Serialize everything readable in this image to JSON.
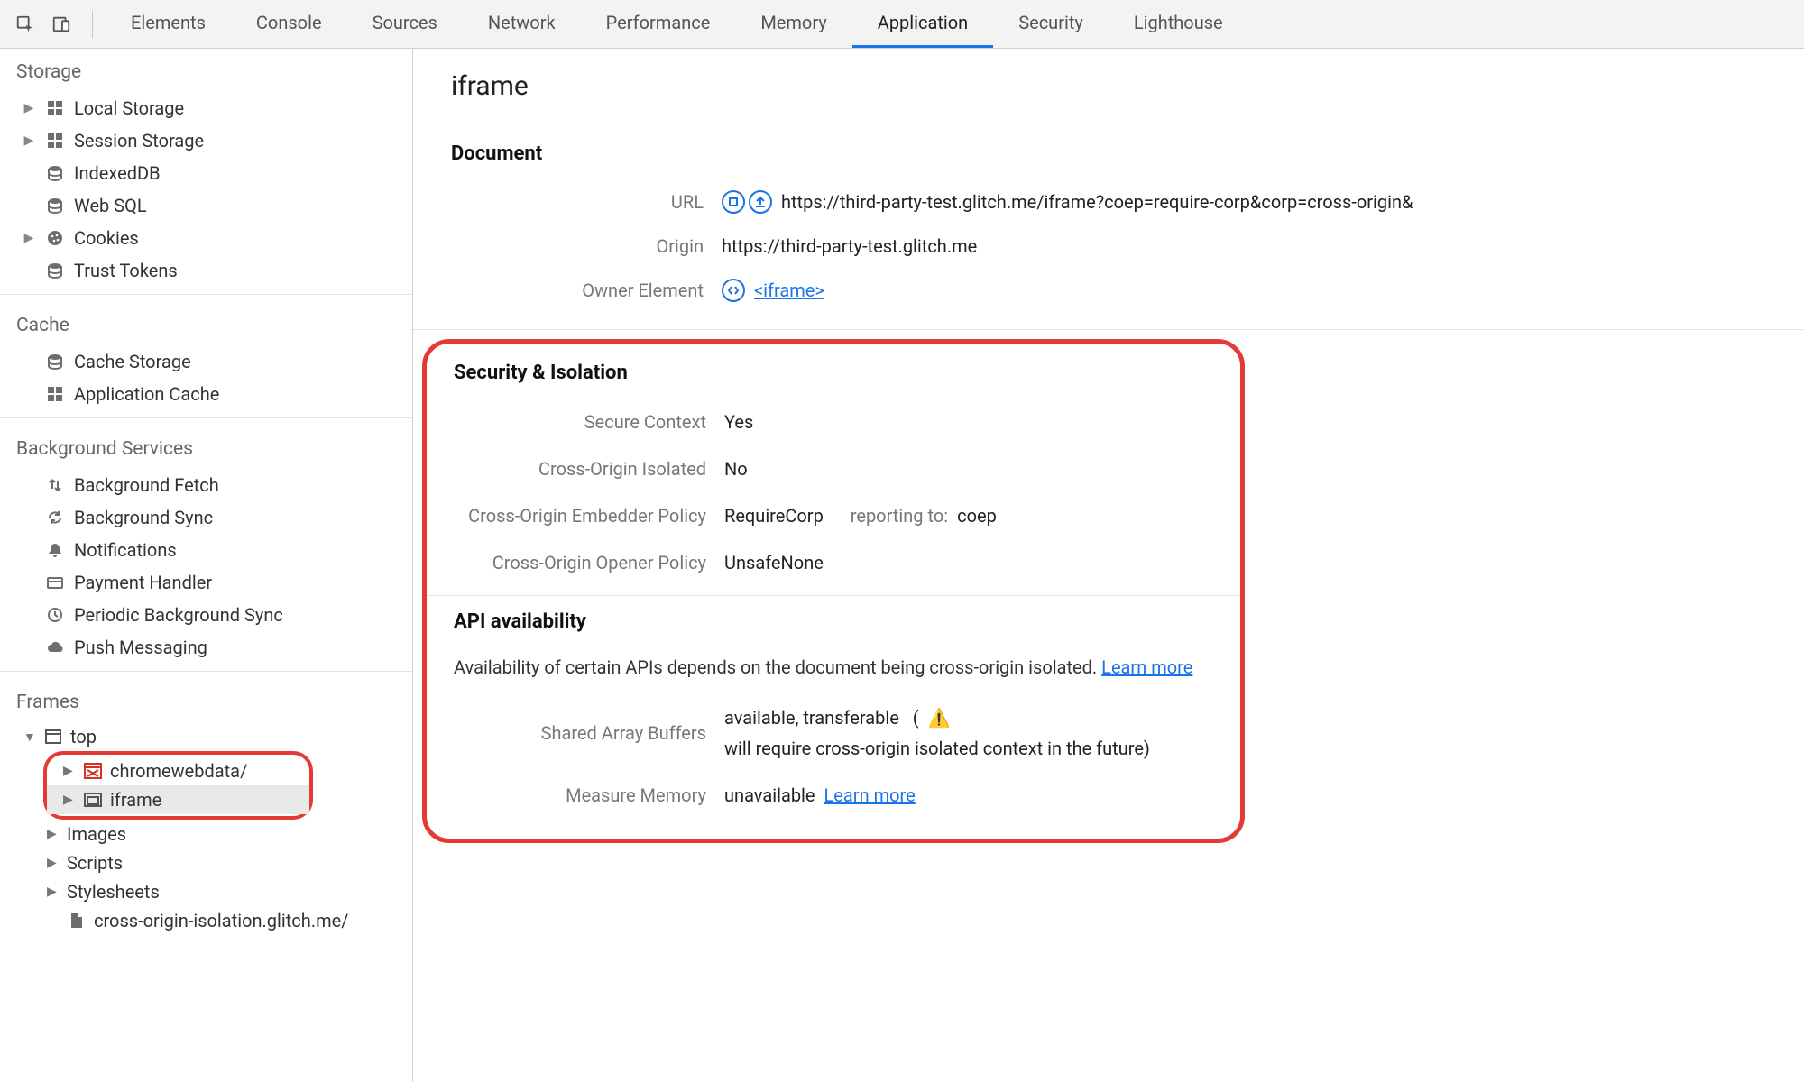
{
  "topbar": {
    "tabs": [
      "Elements",
      "Console",
      "Sources",
      "Network",
      "Performance",
      "Memory",
      "Application",
      "Security",
      "Lighthouse"
    ],
    "active": "Application"
  },
  "sidebar": {
    "storage": {
      "title": "Storage",
      "items": [
        {
          "label": "Local Storage",
          "expandable": true
        },
        {
          "label": "Session Storage",
          "expandable": true
        },
        {
          "label": "IndexedDB",
          "expandable": false
        },
        {
          "label": "Web SQL",
          "expandable": false
        },
        {
          "label": "Cookies",
          "expandable": true
        },
        {
          "label": "Trust Tokens",
          "expandable": false
        }
      ]
    },
    "cache": {
      "title": "Cache",
      "items": [
        {
          "label": "Cache Storage"
        },
        {
          "label": "Application Cache"
        }
      ]
    },
    "background": {
      "title": "Background Services",
      "items": [
        {
          "label": "Background Fetch"
        },
        {
          "label": "Background Sync"
        },
        {
          "label": "Notifications"
        },
        {
          "label": "Payment Handler"
        },
        {
          "label": "Periodic Background Sync"
        },
        {
          "label": "Push Messaging"
        }
      ]
    },
    "frames": {
      "title": "Frames",
      "top": "top",
      "highlighted": [
        {
          "label": "chromewebdata/",
          "icon": "frame-red"
        },
        {
          "label": "iframe",
          "icon": "frame-gray",
          "selected": true
        }
      ],
      "under": [
        "Images",
        "Scripts",
        "Stylesheets"
      ],
      "lastFile": "cross-origin-isolation.glitch.me/"
    }
  },
  "content": {
    "title": "iframe",
    "document": {
      "heading": "Document",
      "url_label": "URL",
      "url": "https://third-party-test.glitch.me/iframe?coep=require-corp&corp=cross-origin&",
      "origin_label": "Origin",
      "origin": "https://third-party-test.glitch.me",
      "owner_label": "Owner Element",
      "owner_link": "<iframe>"
    },
    "security": {
      "heading": "Security & Isolation",
      "secure_label": "Secure Context",
      "secure_value": "Yes",
      "coi_label": "Cross-Origin Isolated",
      "coi_value": "No",
      "coep_label": "Cross-Origin Embedder Policy",
      "coep_value": "RequireCorp",
      "coep_note_label": "reporting to:",
      "coep_note_value": "coep",
      "coop_label": "Cross-Origin Opener Policy",
      "coop_value": "UnsafeNone"
    },
    "api": {
      "heading": "API availability",
      "description": "Availability of certain APIs depends on the document being cross-origin isolated.",
      "learn_more": "Learn more",
      "sab_label": "Shared Array Buffers",
      "sab_value": "available, transferable",
      "sab_warning": "will require cross-origin isolated context in the future)",
      "mm_label": "Measure Memory",
      "mm_value": "unavailable",
      "mm_link": "Learn more"
    }
  }
}
